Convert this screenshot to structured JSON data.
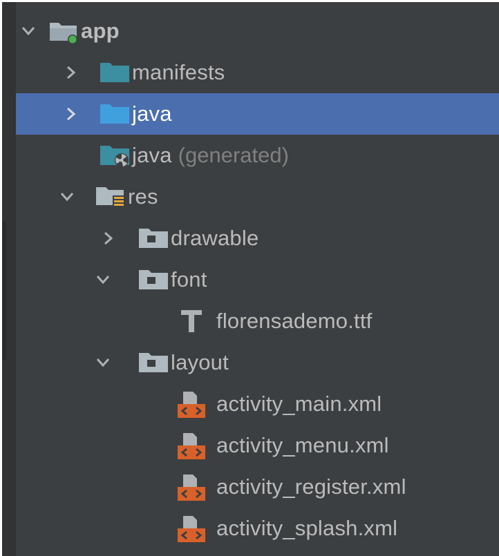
{
  "tree": {
    "app": {
      "label": "app",
      "icon": "module-folder-icon",
      "expanded": true
    },
    "manifests": {
      "label": "manifests",
      "icon": "folder-icon"
    },
    "java": {
      "label": "java",
      "icon": "source-folder-icon",
      "selected": true
    },
    "java_generated": {
      "label": "java",
      "suffix": "(generated)",
      "icon": "generated-sources-folder-icon"
    },
    "res": {
      "label": "res",
      "icon": "resources-folder-icon",
      "expanded": true
    },
    "drawable": {
      "label": "drawable",
      "icon": "folder-icon"
    },
    "font": {
      "label": "font",
      "icon": "folder-icon",
      "expanded": true
    },
    "font_file": {
      "label": "florensademo.ttf",
      "icon": "font-file-icon"
    },
    "layout": {
      "label": "layout",
      "icon": "folder-icon",
      "expanded": true
    },
    "layout_files": [
      {
        "label": "activity_main.xml",
        "icon": "layout-xml-icon"
      },
      {
        "label": "activity_menu.xml",
        "icon": "layout-xml-icon"
      },
      {
        "label": "activity_register.xml",
        "icon": "layout-xml-icon"
      },
      {
        "label": "activity_splash.xml",
        "icon": "layout-xml-icon"
      }
    ]
  },
  "colors": {
    "panel_bg": "#3c3f41",
    "selection_bg": "#4b6eaf",
    "text": "#bbbbbb",
    "muted_text": "#808080",
    "folder_teal": "#3c8fa0",
    "folder_blue": "#40a0de",
    "folder_gray": "#aeb9c0",
    "xml_orange": "#d8612a"
  }
}
